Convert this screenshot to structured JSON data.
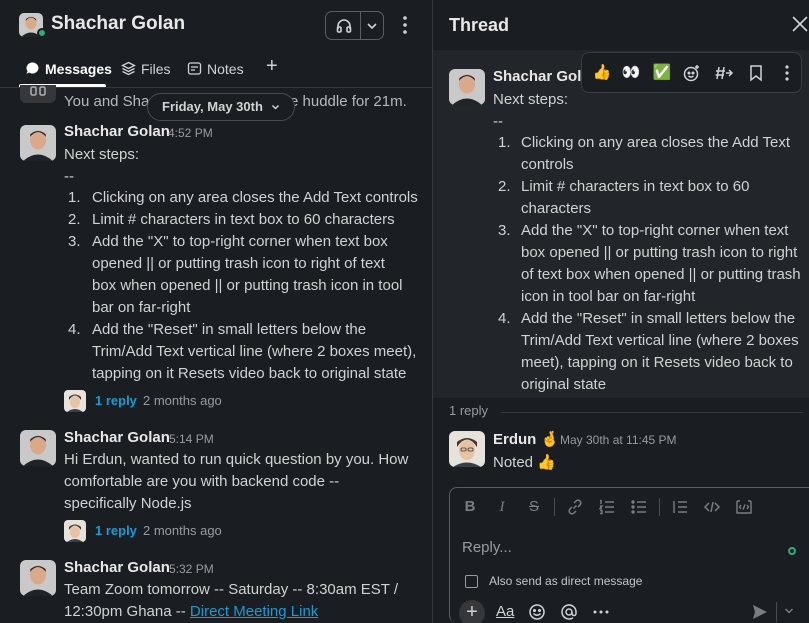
{
  "channel": {
    "title": "Shachar Golan",
    "tabs": [
      {
        "label": "Messages",
        "icon": "chat-bubble-icon",
        "active": true
      },
      {
        "label": "Files",
        "icon": "layers-icon"
      },
      {
        "label": "Notes",
        "icon": "notes-icon"
      }
    ],
    "add_tab": "+"
  },
  "huddle_note": "You and Shachar were in the huddle for 21m.",
  "huddle_note_visible_left": "You and Shac",
  "huddle_note_visible_right": "e huddle for 21m.",
  "date_pill": "Friday, May 30th",
  "messages": [
    {
      "author": "Shachar Golan",
      "time": "4:52 PM",
      "lines": [
        "Next steps:",
        "--"
      ],
      "list": [
        {
          "num": "1.",
          "lines": [
            "Clicking on any area closes the Add Text controls"
          ]
        },
        {
          "num": "2.",
          "lines": [
            "Limit # characters in text box to 60 characters"
          ]
        },
        {
          "num": "3.",
          "lines": [
            "Add the \"X\" to top-right corner when text box",
            "opened || or putting trash icon to right of text",
            "box when opened || or putting trash icon in tool",
            "bar on far-right"
          ]
        },
        {
          "num": "4.",
          "lines": [
            "Add the \"Reset\" in small letters below the",
            "Trim/Add Text vertical line (where 2 boxes meet),",
            "tapping on it Resets video back to original state"
          ]
        }
      ],
      "reply_count": "1 reply",
      "reply_ago": "2 months ago"
    },
    {
      "author": "Shachar Golan",
      "time": "5:14 PM",
      "lines": [
        "Hi Erdun, wanted to run quick question by you. How",
        "comfortable are you with backend code --",
        "specifically Node.js"
      ],
      "reply_count": "1 reply",
      "reply_ago": "2 months ago"
    },
    {
      "author": "Shachar Golan",
      "time": "5:32 PM",
      "lines": [
        "Team Zoom tomorrow -- Saturday -- 8:30am EST /"
      ],
      "line2_prefix": "12:30pm Ghana -- ",
      "line2_link": "Direct Meeting Link"
    }
  ],
  "thread": {
    "title": "Thread",
    "parent": {
      "author": "Shachar Golan",
      "author_visible": "Shachar Golan",
      "lines": [
        "Next steps:",
        "--"
      ],
      "list": [
        {
          "num": "1.",
          "lines": [
            "Clicking on any area closes the Add Text",
            "controls"
          ]
        },
        {
          "num": "2.",
          "lines": [
            "Limit # characters in text box to 60",
            "characters"
          ]
        },
        {
          "num": "3.",
          "lines": [
            "Add the \"X\" to top-right corner when text",
            "box opened || or putting trash icon to right",
            "of text box when opened || or putting trash",
            "icon in tool bar on far-right"
          ]
        },
        {
          "num": "4.",
          "lines": [
            "Add the \"Reset\" in small letters below the",
            "Trim/Add Text vertical line (where 2 boxes",
            "meet), tapping on it Resets video back to",
            "original state"
          ]
        }
      ]
    },
    "hover_actions": [
      "👍",
      "👀",
      "✅",
      "add-reaction-icon",
      "forward-icon",
      "bookmark-icon",
      "more-icon"
    ],
    "reply_separator": "1 reply",
    "reply": {
      "author": "Erdun",
      "author_emoji": "🤞",
      "time": "May 30th at 11:45 PM",
      "text": "Noted",
      "text_emoji": "👍"
    },
    "composer": {
      "placeholder": "Reply...",
      "also_send": "Also send as direct message",
      "format_label": "Aa"
    }
  }
}
